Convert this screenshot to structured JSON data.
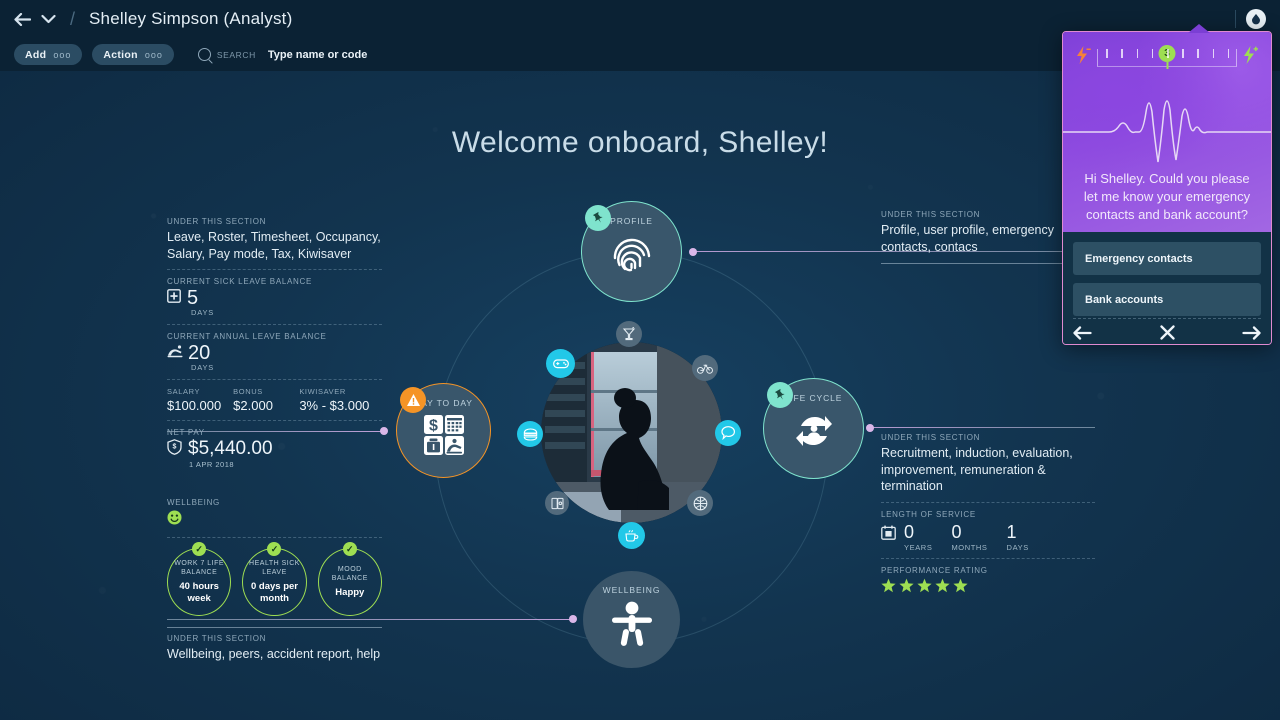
{
  "header": {
    "back_icon": "back-arrow-icon",
    "dropdown_icon": "chevron-down-icon",
    "separator": "/",
    "title": "Shelley Simpson (Analyst)",
    "avatar_icon": "user-avatar-icon"
  },
  "toolbar": {
    "add_label": "Add",
    "add_dots": "ooo",
    "action_label": "Action",
    "action_dots": "ooo",
    "search_label": "SEARCH",
    "search_placeholder": "Type name or code",
    "search_value": ""
  },
  "welcome": {
    "text": "Welcome onboard, Shelley!"
  },
  "nodes": {
    "profile": {
      "label": "PROFILE",
      "icon": "fingerprint-icon",
      "badge": "pin-icon"
    },
    "life_cycle": {
      "label": "LIFE CYCLE",
      "icon": "lifecycle-refresh-icon",
      "badge": "pin-icon"
    },
    "day_to_day": {
      "label": "DAY TO DAY",
      "icon": "payroll-calendar-icon",
      "badge": "warning-icon"
    },
    "wellbeing": {
      "label": "WELLBEING",
      "icon": "person-icon"
    }
  },
  "lifestyle_icons": [
    {
      "name": "cocktail-icon",
      "color": "gray"
    },
    {
      "name": "gamepad-icon",
      "color": "cyan"
    },
    {
      "name": "bicycle-icon",
      "color": "gray"
    },
    {
      "name": "burger-icon",
      "color": "cyan"
    },
    {
      "name": "chat-bubble-icon",
      "color": "cyan"
    },
    {
      "name": "book-icon",
      "color": "gray"
    },
    {
      "name": "basketball-icon",
      "color": "gray"
    },
    {
      "name": "coffee-icon",
      "color": "cyan"
    }
  ],
  "day_to_day_panel": {
    "kicker": "UNDER THIS SECTION",
    "body": "Leave, Roster, Timesheet, Occupancy, Salary, Pay mode, Tax, Kiwisaver",
    "sick_leave_kicker": "CURRENT SICK LEAVE BALANCE",
    "sick_leave_icon": "medical-cross-icon",
    "sick_leave_value": "5",
    "sick_leave_unit": "DAYS",
    "annual_leave_kicker": "CURRENT ANNUAL LEAVE BALANCE",
    "annual_leave_icon": "beach-chair-icon",
    "annual_leave_value": "20",
    "annual_leave_unit": "DAYS",
    "money": [
      {
        "label": "SALARY",
        "value": "$100.000"
      },
      {
        "label": "BONUS",
        "value": "$2.000"
      },
      {
        "label": "KIWISAVER",
        "value": "3% - $3.000"
      }
    ],
    "net_pay_kicker": "NET PAY",
    "net_pay_icon": "dollar-shield-icon",
    "net_pay_value": "$5,440.00",
    "net_pay_date": "1 APR 2018"
  },
  "wellbeing_panel": {
    "kicker": "WELLBEING",
    "smiley_icon": "smiley-face-icon",
    "rings": [
      {
        "title": "WORK 7 LIFE BALANCE",
        "value": "40 hours week",
        "check": "check-icon"
      },
      {
        "title": "HEALTH SICK LEAVE",
        "value": "0 days per month",
        "check": "check-icon"
      },
      {
        "title": "MOOD BALANCE",
        "value": "Happy",
        "check": "check-icon"
      }
    ],
    "section_kicker": "UNDER THIS SECTION",
    "section_body": "Wellbeing, peers, accident report, help"
  },
  "profile_panel": {
    "kicker": "UNDER THIS SECTION",
    "body": "Profile, user profile, emergency contacts, contacs"
  },
  "life_cycle_panel": {
    "kicker": "UNDER THIS SECTION",
    "body": "Recruitment, induction, evaluation, improvement, remuneration & termination",
    "service_kicker": "LENGTH OF SERVICE",
    "service_icon": "calendar-briefcase-icon",
    "service": [
      {
        "value": "0",
        "unit": "YEARS"
      },
      {
        "value": "0",
        "unit": "MONTHS"
      },
      {
        "value": "1",
        "unit": "DAYS"
      }
    ],
    "rating_kicker": "PERFORMANCE RATING",
    "rating_stars": 5,
    "star_icon": "star-icon"
  },
  "assistant": {
    "minus_icon": "lightning-minus-icon",
    "plus_icon": "lightning-plus-icon",
    "slider_value": "3",
    "slider_ticks": 9,
    "waveform_icon": "audio-waveform-icon",
    "message": "Hi Shelley. Could you please let me know your emergency contacts and bank account?",
    "options": [
      {
        "label": "Emergency contacts"
      },
      {
        "label": "Bank accounts"
      }
    ],
    "prev_icon": "arrow-left-icon",
    "close_icon": "close-x-icon",
    "next_icon": "arrow-right-icon"
  },
  "colors": {
    "background": "#0e2a42",
    "topbar": "#0b2234",
    "accent_teal": "#7fe3cd",
    "accent_orange": "#f59426",
    "accent_cyan": "#22c8e8",
    "accent_green": "#9ede52",
    "accent_purple": "#8f4ce0",
    "connector_pink": "#d9b6e8"
  }
}
